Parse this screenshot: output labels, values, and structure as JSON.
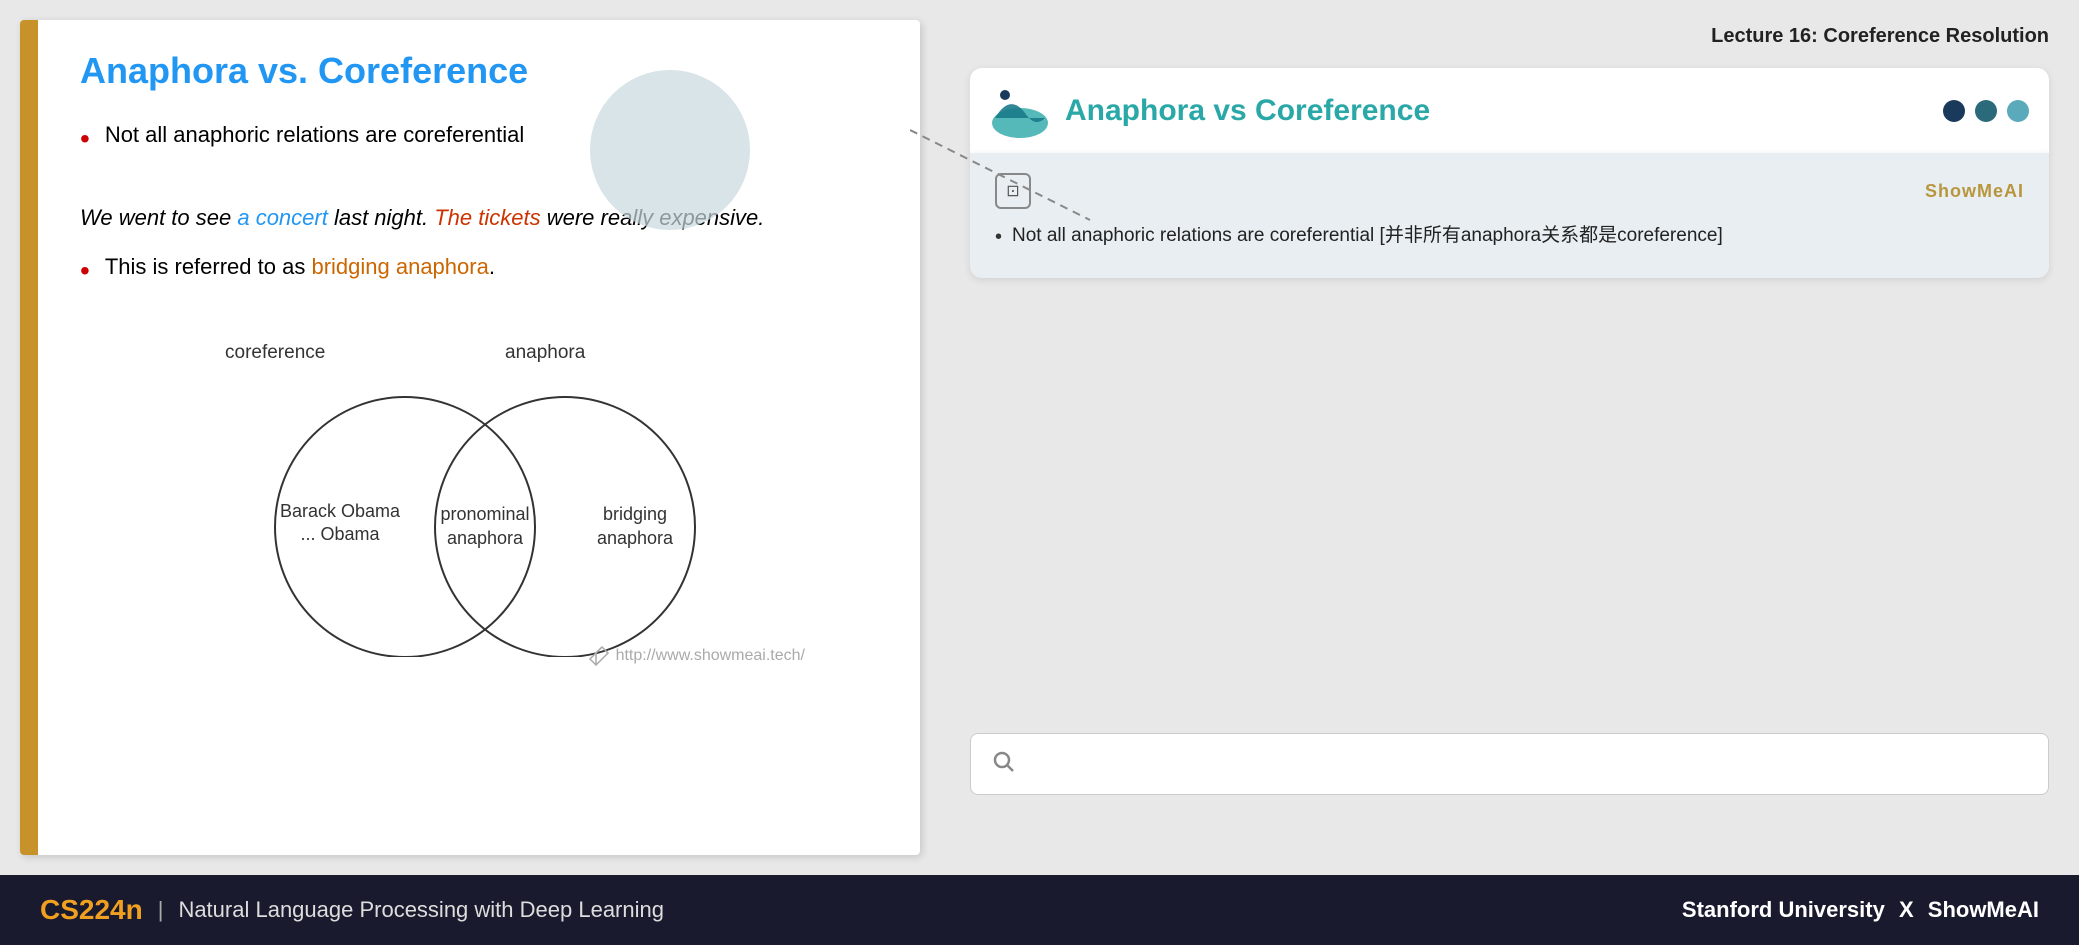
{
  "lecture": {
    "title": "Lecture 16: Coreference Resolution"
  },
  "slide": {
    "title": "Anaphora vs. Coreference",
    "left_bar_color": "#c8922a",
    "bullet1": "Not all anaphoric relations are coreferential",
    "example": {
      "prefix": "We went to see ",
      "concert": "a concert",
      "middle": " last night. ",
      "tickets": "The tickets",
      "suffix": " were really expensive."
    },
    "bullet2_prefix": "This is referred to as ",
    "bullet2_link": "bridging anaphora",
    "bullet2_suffix": ".",
    "venn": {
      "label_left": "coreference",
      "label_right": "anaphora",
      "left_inner": "Barack Obama\n... Obama",
      "center": "pronominal\nanaphora",
      "right": "bridging\nanaphora"
    },
    "watermark": "http://www.showmeai.tech/"
  },
  "right_panel": {
    "preview_title": "Anaphora vs Coreference",
    "ai_brand": "ShowMeAI",
    "ai_content": "Not all anaphoric relations are coreferential [并非所有anaphora关系都是coreference]",
    "dots": [
      "dark",
      "teal",
      "light-teal"
    ]
  },
  "bottom_bar": {
    "course": "CS224n",
    "separator": "|",
    "description": "Natural Language Processing with Deep Learning",
    "university": "Stanford University",
    "x": "X",
    "brand": "ShowMeAI"
  },
  "search": {
    "placeholder": ""
  }
}
